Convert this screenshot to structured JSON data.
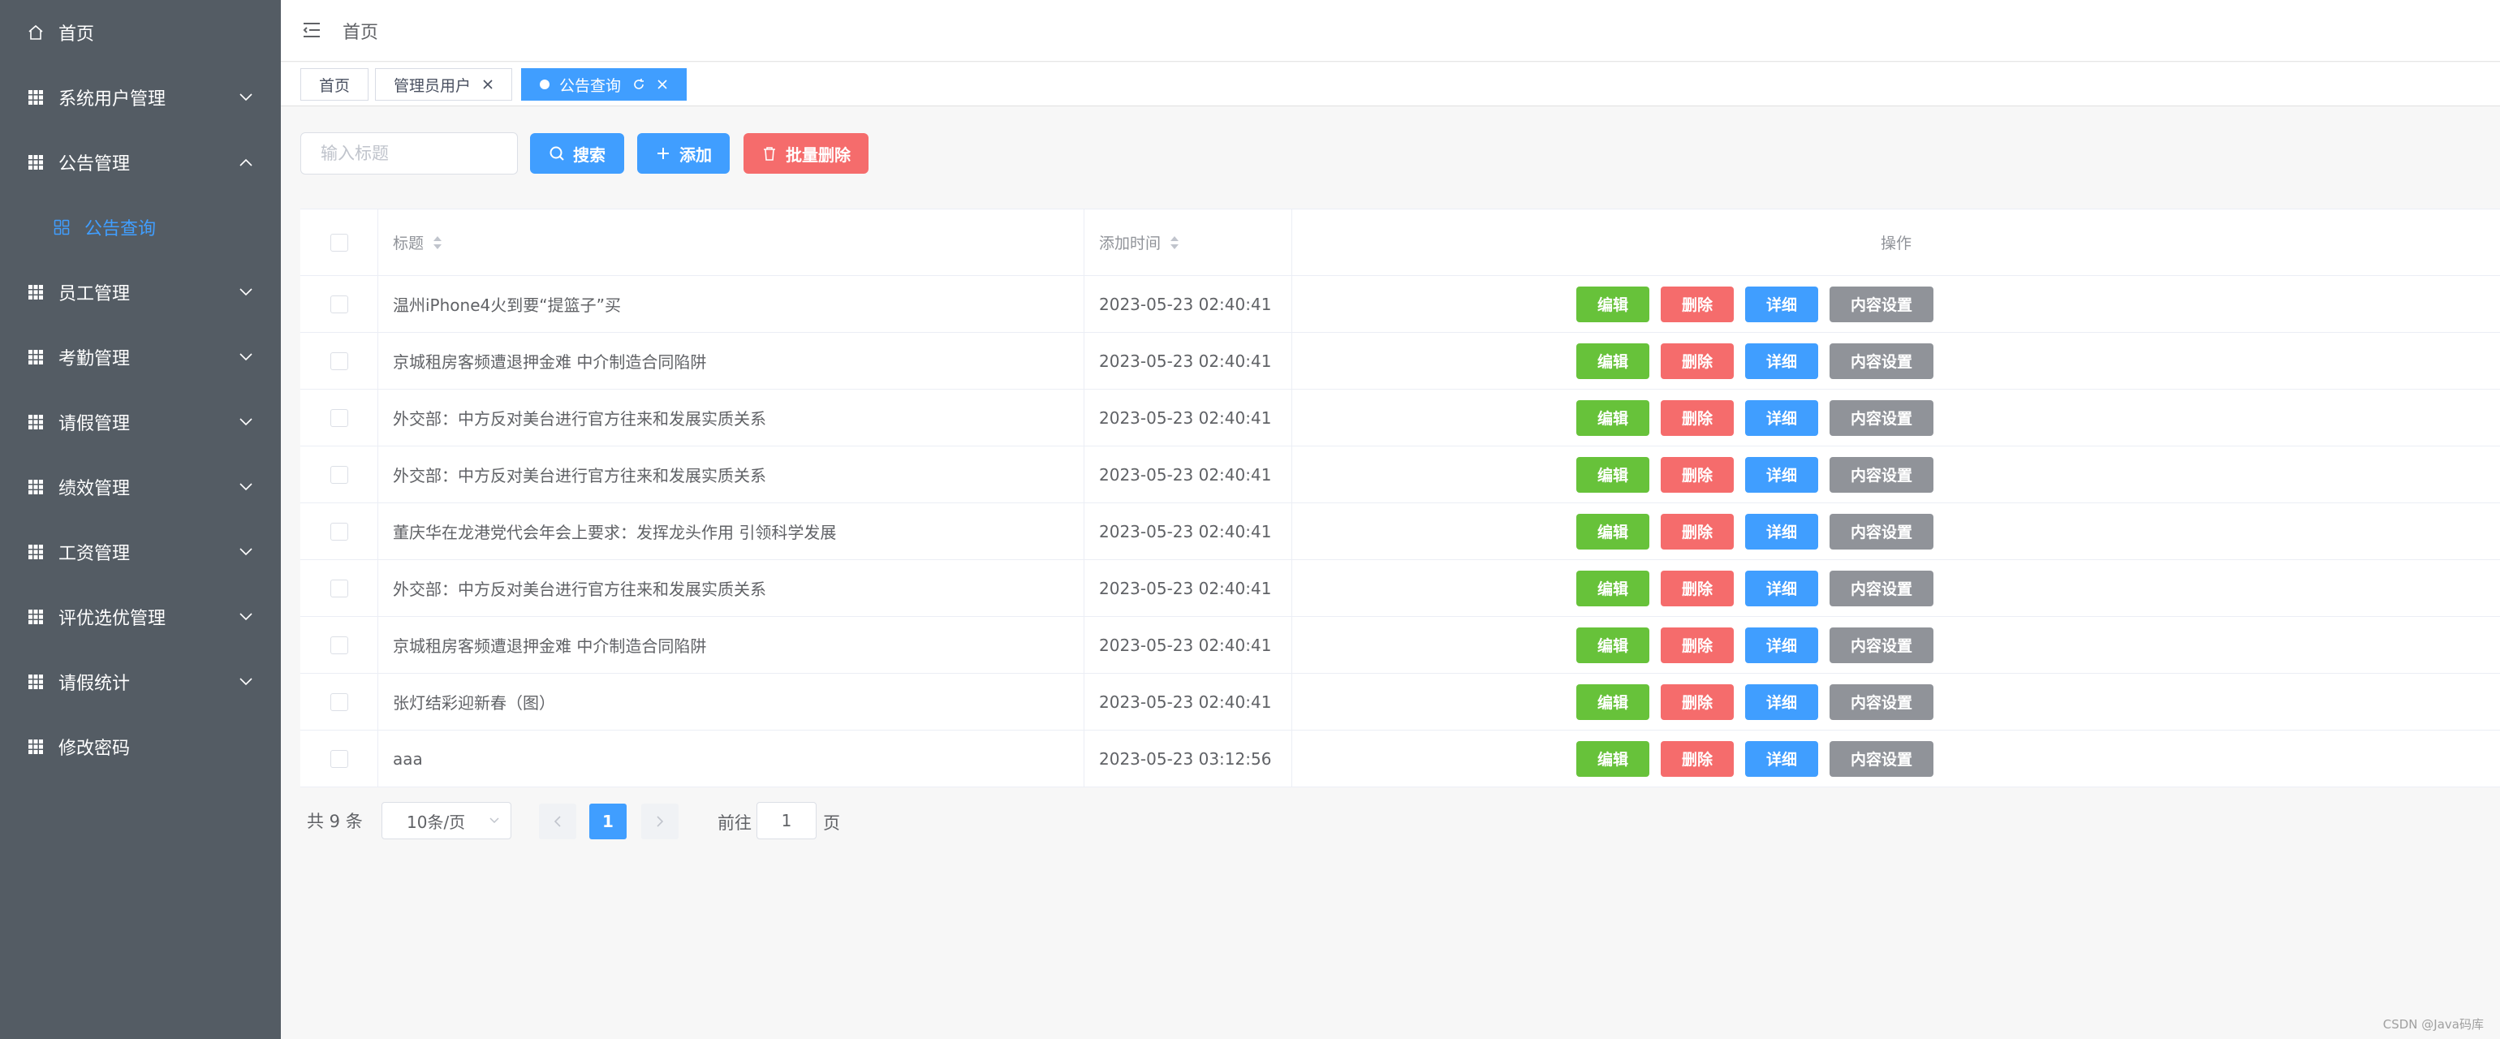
{
  "sidebar": {
    "items": [
      {
        "label": "首页",
        "icon": "home-icon",
        "has_arrow": false
      },
      {
        "label": "系统用户管理",
        "icon": "grid-icon",
        "has_arrow": true,
        "expanded": false
      },
      {
        "label": "公告管理",
        "icon": "grid-icon",
        "has_arrow": true,
        "expanded": true
      },
      {
        "label": "公告查询",
        "icon": "grid-icon",
        "sub": true,
        "active": true
      },
      {
        "label": "员工管理",
        "icon": "grid-icon",
        "has_arrow": true,
        "expanded": false
      },
      {
        "label": "考勤管理",
        "icon": "grid-icon",
        "has_arrow": true,
        "expanded": false
      },
      {
        "label": "请假管理",
        "icon": "grid-icon",
        "has_arrow": true,
        "expanded": false
      },
      {
        "label": "绩效管理",
        "icon": "grid-icon",
        "has_arrow": true,
        "expanded": false
      },
      {
        "label": "工资管理",
        "icon": "grid-icon",
        "has_arrow": true,
        "expanded": false
      },
      {
        "label": "评优选优管理",
        "icon": "grid-icon",
        "has_arrow": true,
        "expanded": false
      },
      {
        "label": "请假统计",
        "icon": "grid-icon",
        "has_arrow": true,
        "expanded": false
      },
      {
        "label": "修改密码",
        "icon": "grid-icon",
        "has_arrow": false
      }
    ]
  },
  "header": {
    "breadcrumb": "首页"
  },
  "tags": [
    {
      "label": "首页",
      "closable": false,
      "active": false
    },
    {
      "label": "管理员用户",
      "closable": true,
      "active": false
    },
    {
      "label": "公告查询",
      "closable": true,
      "active": true
    }
  ],
  "toolbar": {
    "search_placeholder": "输入标题",
    "search_value": "",
    "search_label": "搜索",
    "add_label": "添加",
    "batch_delete_label": "批量删除"
  },
  "table": {
    "columns": {
      "title": "标题",
      "time": "添加时间",
      "ops": "操作"
    },
    "rows": [
      {
        "title": "温州iPhone4火到要“提篮子”买",
        "time": "2023-05-23 02:40:41"
      },
      {
        "title": "京城租房客频遭退押金难 中介制造合同陷阱",
        "time": "2023-05-23 02:40:41"
      },
      {
        "title": "外交部：中方反对美台进行官方往来和发展实质关系",
        "time": "2023-05-23 02:40:41"
      },
      {
        "title": "外交部：中方反对美台进行官方往来和发展实质关系",
        "time": "2023-05-23 02:40:41"
      },
      {
        "title": "董庆华在龙港党代会年会上要求：发挥龙头作用 引领科学发展",
        "time": "2023-05-23 02:40:41"
      },
      {
        "title": "外交部：中方反对美台进行官方往来和发展实质关系",
        "time": "2023-05-23 02:40:41"
      },
      {
        "title": "京城租房客频遭退押金难 中介制造合同陷阱",
        "time": "2023-05-23 02:40:41"
      },
      {
        "title": "张灯结彩迎新春（图）",
        "time": "2023-05-23 02:40:41"
      },
      {
        "title": "aaa",
        "time": "2023-05-23 03:12:56"
      }
    ],
    "op_labels": {
      "edit": "编辑",
      "delete": "删除",
      "detail": "详细",
      "content": "内容设置"
    }
  },
  "pagination": {
    "total_text": "共 9 条",
    "page_size": "10条/页",
    "current_page": "1",
    "goto_label": "前往",
    "goto_value": "1",
    "goto_suffix": "页"
  },
  "watermark": "CSDN @Java码库",
  "colors": {
    "sidebar_bg": "#545c64",
    "primary": "#409eff",
    "success": "#67c23a",
    "danger": "#f56c6c",
    "info": "#909399"
  }
}
